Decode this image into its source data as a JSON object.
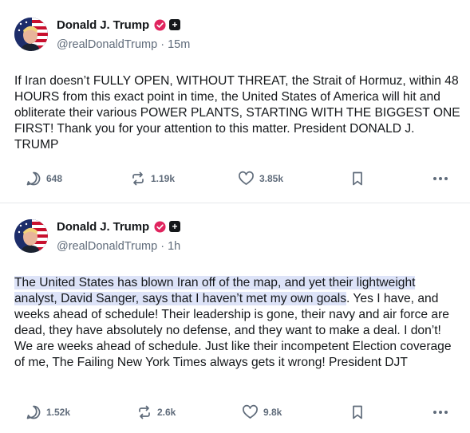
{
  "colors": {
    "text": "#14171a",
    "muted": "#5f6b7a",
    "verified": "#e0245e",
    "highlight": "#dde3f8",
    "divider": "#e6e8eb"
  },
  "posts": [
    {
      "author": {
        "name": "Donald J. Trump",
        "handle": "@realDonaldTrump",
        "sep": "·",
        "time": "15m"
      },
      "text_highlighted": "",
      "text": "If Iran doesn’t FULLY OPEN, WITHOUT THREAT, the Strait of Hormuz, within 48 HOURS from this exact point in time, the United States of America will hit and obliterate their various POWER PLANTS, STARTING WITH THE BIGGEST ONE FIRST! Thank you for your attention to this matter. President DONALD J. TRUMP",
      "stats": {
        "replies": "648",
        "reposts": "1.19k",
        "likes": "3.85k"
      }
    },
    {
      "author": {
        "name": "Donald J. Trump",
        "handle": "@realDonaldTrump",
        "sep": "·",
        "time": "1h"
      },
      "text_highlighted": "The United States has blown Iran off of the map, and yet their lightweight analyst, David Sanger, says that I haven’t met my own goals",
      "text": ". Yes I have, and weeks ahead of schedule! Their leadership is gone, their navy and air force are dead, they have absolutely no defense, and they want to make a deal. I don’t! We are weeks ahead of schedule. Just like their incompetent Election coverage of me, The Failing New York Times always gets it wrong! President DJT",
      "stats": {
        "replies": "1.52k",
        "reposts": "2.6k",
        "likes": "9.8k"
      }
    }
  ],
  "icons": {
    "avatar": "flag-portrait-avatar",
    "verified": "verified-badge-icon",
    "plus": "plus-badge-icon",
    "reply": "reply-icon",
    "repost": "repost-icon",
    "like": "heart-icon",
    "bookmark": "bookmark-icon",
    "more": "more-icon"
  },
  "more_glyph": "•••",
  "plus_glyph": "+"
}
